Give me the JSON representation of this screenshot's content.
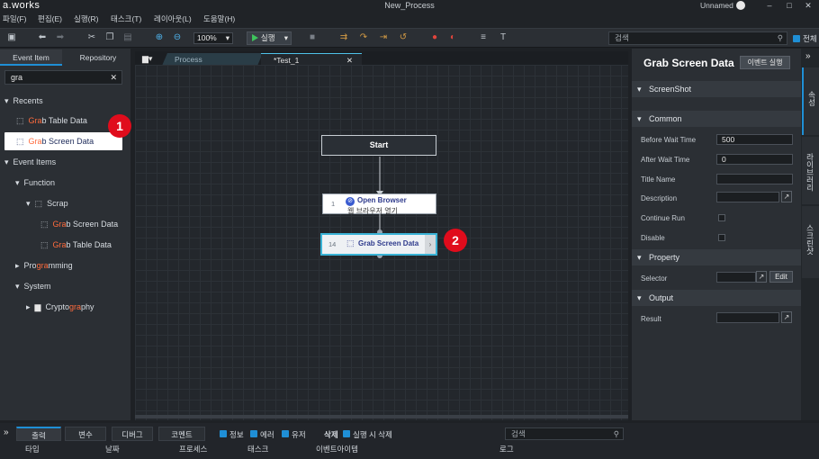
{
  "app": {
    "logo": "a.works",
    "title": "New_Process",
    "user": "Unnamed"
  },
  "menu": [
    "파일(F)",
    "편집(E)",
    "실행(R)",
    "태스크(T)",
    "레이아웃(L)",
    "도움말(H)"
  ],
  "toolbar": {
    "zoom": "100%",
    "run_label": "실행",
    "search_placeholder": "검색",
    "all_label": "전체"
  },
  "left": {
    "tabs": [
      "Event Item",
      "Repository"
    ],
    "search_value": "gra",
    "recents_label": "Recents",
    "recents": [
      {
        "pre": "Gra",
        "post": "b Table Data"
      },
      {
        "pre": "Gra",
        "post": "b Screen Data"
      }
    ],
    "event_items_label": "Event Items",
    "function_label": "Function",
    "scrap_label": "Scrap",
    "scrap_items": [
      {
        "pre": "Gra",
        "post": "b Screen Data"
      },
      {
        "pre": "Gra",
        "post": "b Table Data"
      }
    ],
    "programming": {
      "pre": "Pro",
      "hl": "gra",
      "post": "mming"
    },
    "system_label": "System",
    "crypto": {
      "pre": "Crypto",
      "hl": "gra",
      "post": "phy"
    }
  },
  "doc_tabs": [
    "Process",
    "*Test_1"
  ],
  "flow": {
    "start": "Start",
    "node1": {
      "num": "1",
      "title": "Open Browser",
      "sub": "웹 브라우저 열기"
    },
    "node2": {
      "num": "14",
      "title": "Grab Screen Data"
    }
  },
  "annotations": [
    "1",
    "2"
  ],
  "right": {
    "title": "Grab Screen Data",
    "event_button": "이벤트 실행",
    "screenshot_label": "ScreenShot",
    "common_label": "Common",
    "fields": [
      {
        "label": "Before Wait Time",
        "value": "500"
      },
      {
        "label": "After Wait Time",
        "value": "0"
      },
      {
        "label": "Title Name",
        "value": ""
      },
      {
        "label": "Description",
        "value": ""
      }
    ],
    "continue_run": "Continue Run",
    "disable": "Disable",
    "property_label": "Property",
    "selector_label": "Selector",
    "edit_button": "Edit",
    "output_label": "Output",
    "result_label": "Result",
    "vtabs": [
      "속성",
      "라이브러리",
      "스크린샷"
    ]
  },
  "bottom": {
    "tabs": [
      "출력",
      "변수",
      "디버그",
      "코멘트"
    ],
    "filters": [
      "정보",
      "에러",
      "유저"
    ],
    "delete_label": "삭제",
    "delete_on_run": "실행 시 삭제",
    "search_placeholder": "검색",
    "columns": [
      "타입",
      "날짜",
      "프로세스",
      "태스크",
      "이벤트아이템",
      "로그"
    ]
  },
  "colors": {
    "accent": "#1f8fd6",
    "highlight": "#ff6b3d",
    "marker": "#e00c1c",
    "run_green": "#3ec45c"
  }
}
